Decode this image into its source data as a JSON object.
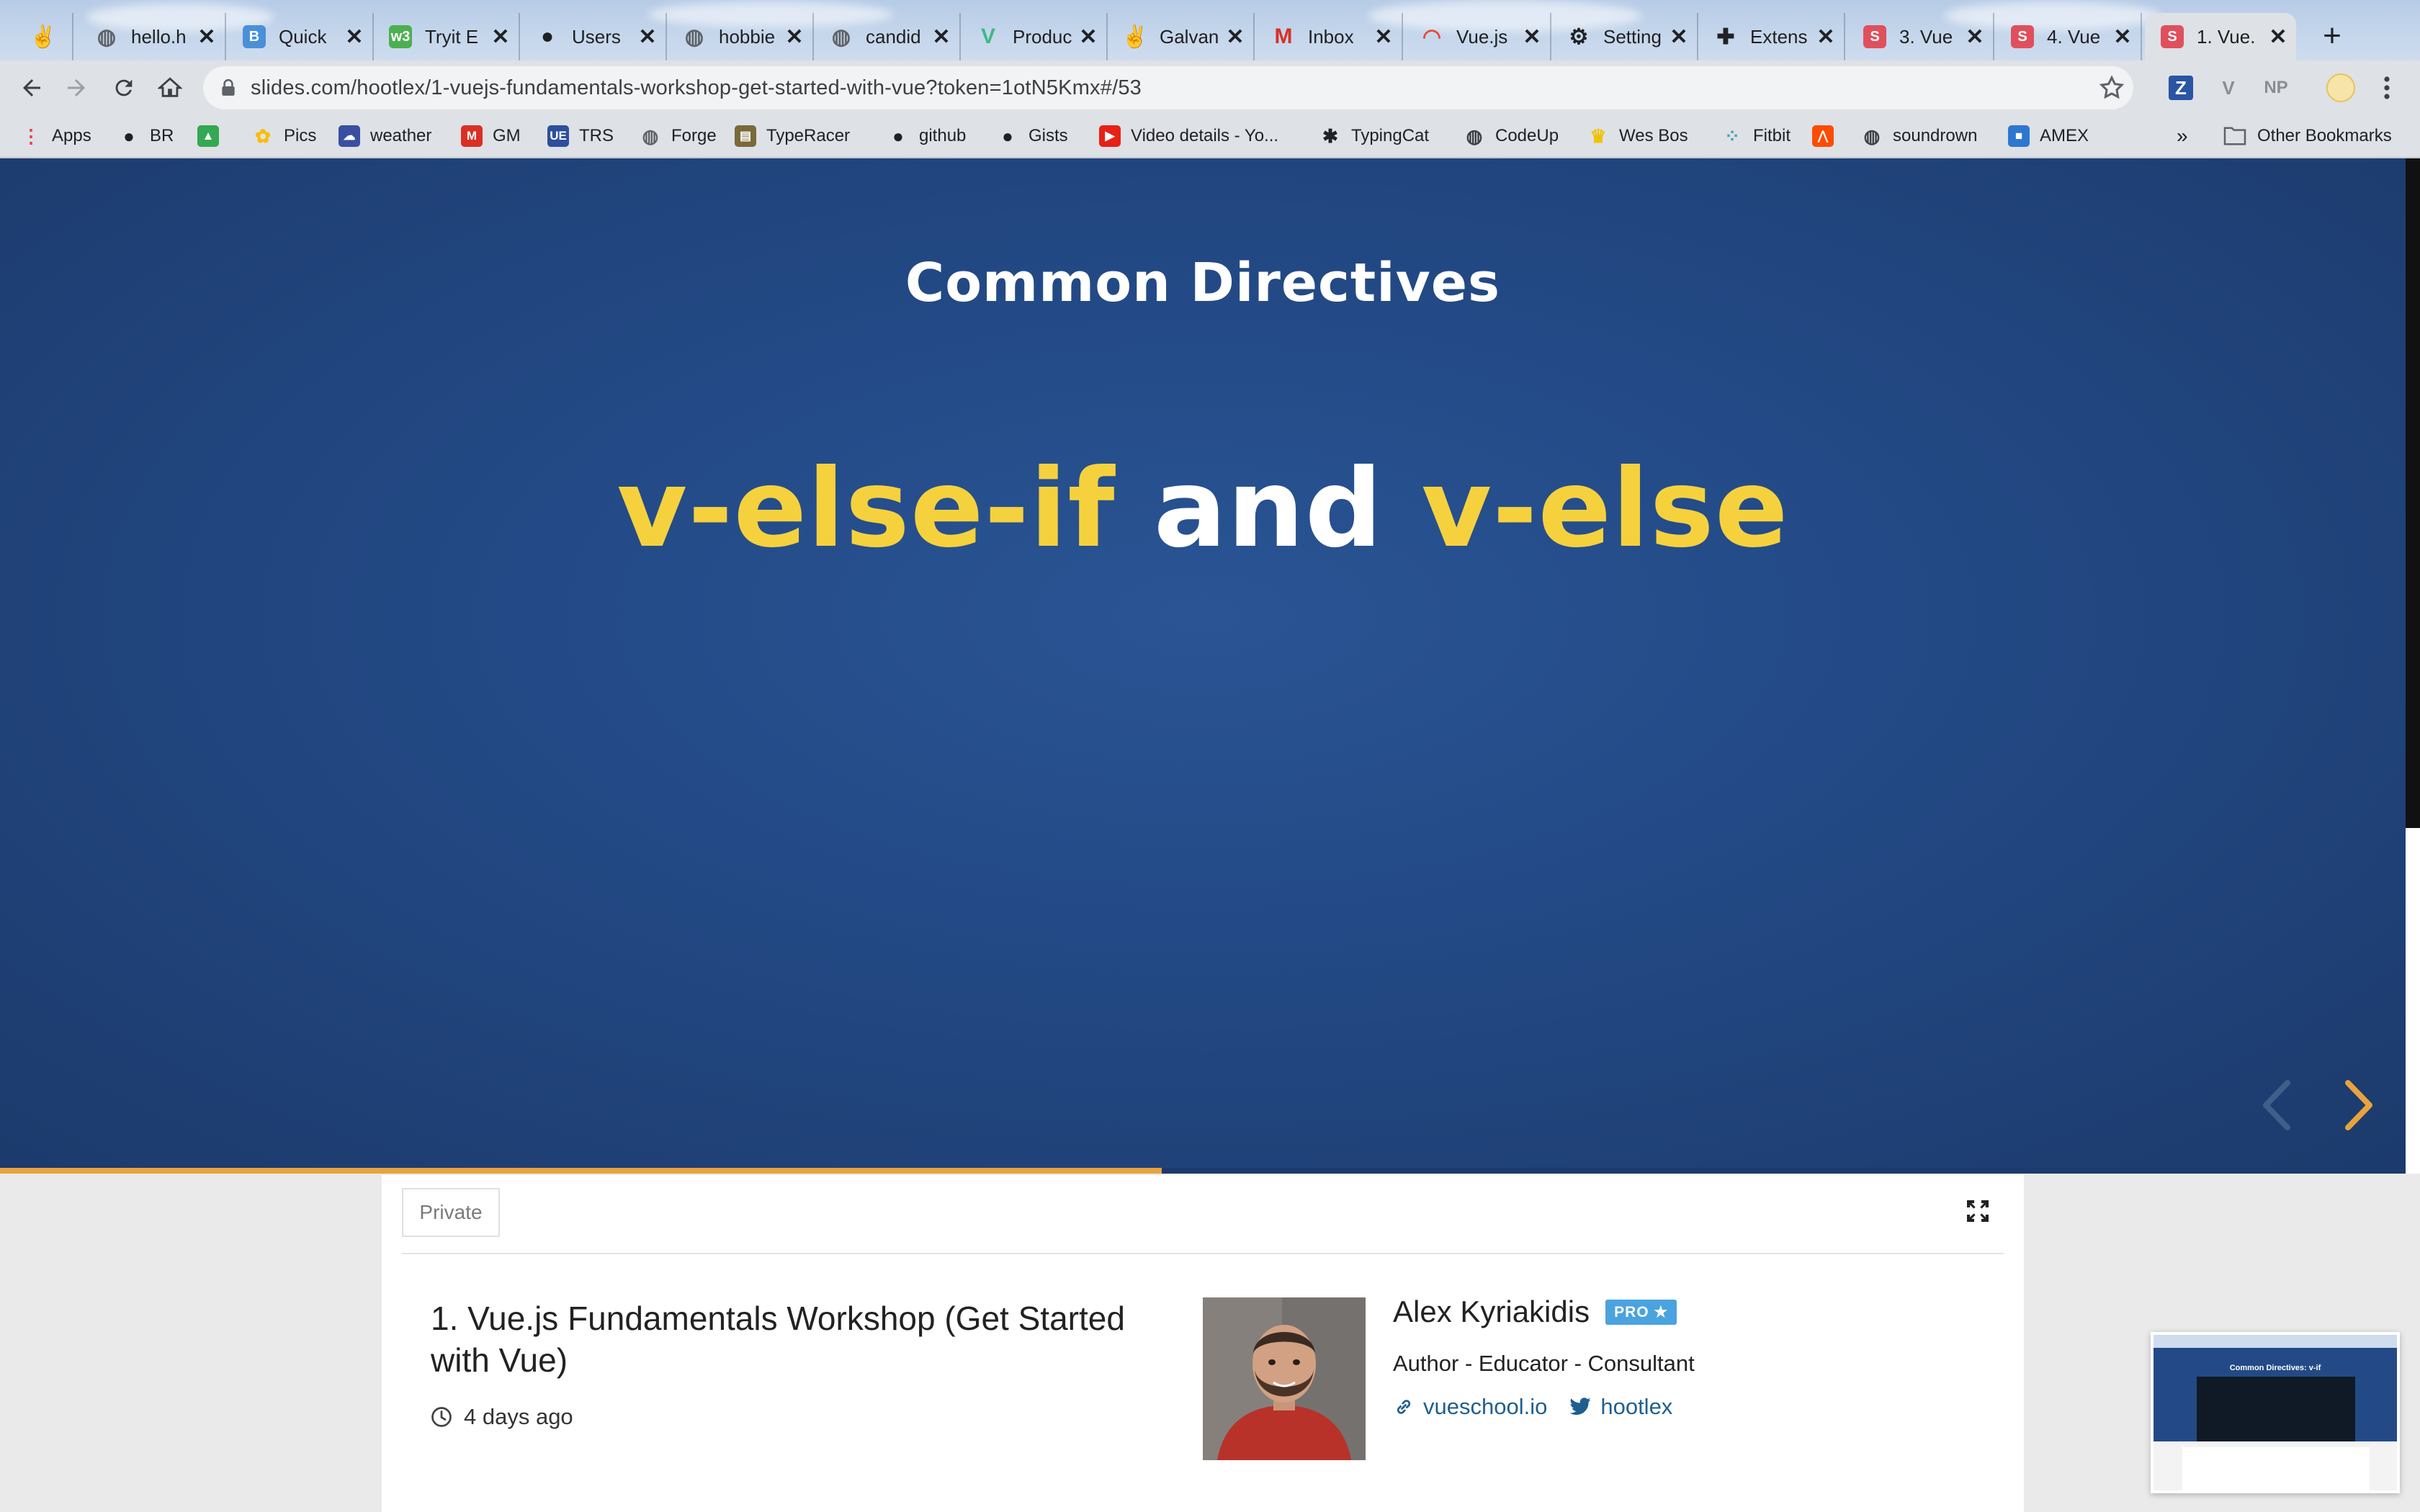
{
  "browser": {
    "tabs": [
      {
        "title": "",
        "icon": "hand-icon",
        "color": "#e7a04b"
      },
      {
        "title": "hello.h",
        "icon": "globe-icon",
        "color": "#5f6368"
      },
      {
        "title": "Quick",
        "icon": "b-icon",
        "color": "#4a90d9"
      },
      {
        "title": "Tryit E",
        "icon": "w3-icon",
        "color": "#4caf50"
      },
      {
        "title": "Users",
        "icon": "github-icon",
        "color": "#202124"
      },
      {
        "title": "hobbie",
        "icon": "globe-icon",
        "color": "#5f6368"
      },
      {
        "title": "candid",
        "icon": "globe-icon",
        "color": "#5f6368"
      },
      {
        "title": "Produc",
        "icon": "vue-icon",
        "color": "#41b883"
      },
      {
        "title": "Galvan",
        "icon": "hand-icon",
        "color": "#e7a04b"
      },
      {
        "title": "Inbox",
        "icon": "gmail-icon",
        "color": "#d93025"
      },
      {
        "title": "Vue.js",
        "icon": "rainbow-icon",
        "color": "#e84a3c"
      },
      {
        "title": "Setting",
        "icon": "gear-icon",
        "color": "#202124"
      },
      {
        "title": "Extens",
        "icon": "puzzle-icon",
        "color": "#202124"
      },
      {
        "title": "3. Vue",
        "icon": "s-icon",
        "color": "#e0505c"
      },
      {
        "title": "4. Vue",
        "icon": "s-icon",
        "color": "#e0505c"
      },
      {
        "title": "1. Vue.",
        "icon": "s-icon",
        "color": "#e0505c",
        "active": true
      }
    ],
    "url": "slides.com/hootlex/1-vuejs-fundamentals-workshop-get-started-with-vue?token=1otN5Kmx#/53",
    "extensions": [
      "Z",
      "V",
      "NP"
    ],
    "bookmarks": [
      {
        "label": "Apps",
        "icon": "apps-icon"
      },
      {
        "label": "BR",
        "icon": "github-icon"
      },
      {
        "label": "",
        "icon": "drive-icon"
      },
      {
        "label": "Pics",
        "icon": "photos-icon"
      },
      {
        "label": "weather",
        "icon": "weather-icon"
      },
      {
        "label": "GM",
        "icon": "gmail-icon"
      },
      {
        "label": "TRS",
        "icon": "trs-icon"
      },
      {
        "label": "Forge",
        "icon": "forge-icon"
      },
      {
        "label": "TypeRacer",
        "icon": "typeracer-icon"
      },
      {
        "label": "github",
        "icon": "github-icon"
      },
      {
        "label": "Gists",
        "icon": "github-icon"
      },
      {
        "label": "Video details - Yo...",
        "icon": "youtube-icon"
      },
      {
        "label": "TypingCat",
        "icon": "paw-icon"
      },
      {
        "label": "CodeUp",
        "icon": "globe-icon"
      },
      {
        "label": "Wes Bos",
        "icon": "crown-icon"
      },
      {
        "label": "Fitbit",
        "icon": "fitbit-icon"
      },
      {
        "label": "",
        "icon": "strava-icon"
      },
      {
        "label": "soundrown",
        "icon": "globe-icon"
      },
      {
        "label": "AMEX",
        "icon": "amex-icon"
      }
    ],
    "bookmarks_overflow": "»",
    "other_bookmarks": "Other Bookmarks"
  },
  "slide": {
    "heading": "Common Directives",
    "title_part1": "v-else-if",
    "title_part2": " and ",
    "title_part3": "v-else",
    "progress": 0.483
  },
  "deck": {
    "visibility": "Private",
    "title": "1. Vue.js Fundamentals Workshop (Get Started with Vue)",
    "updated": "4 days ago"
  },
  "author": {
    "name": "Alex Kyriakidis",
    "badge": "PRO ★",
    "bio": "Author - Educator - Consultant",
    "website": "vueschool.io",
    "twitter": "hootlex"
  },
  "thumbnail": {
    "heading": "Common Directives: v-if"
  },
  "colors": {
    "slide_bg": "#234a86",
    "keyword": "#f5d13e",
    "progress": "#e8a33d",
    "link": "#1f5f8f",
    "pro": "#4aa3df"
  }
}
